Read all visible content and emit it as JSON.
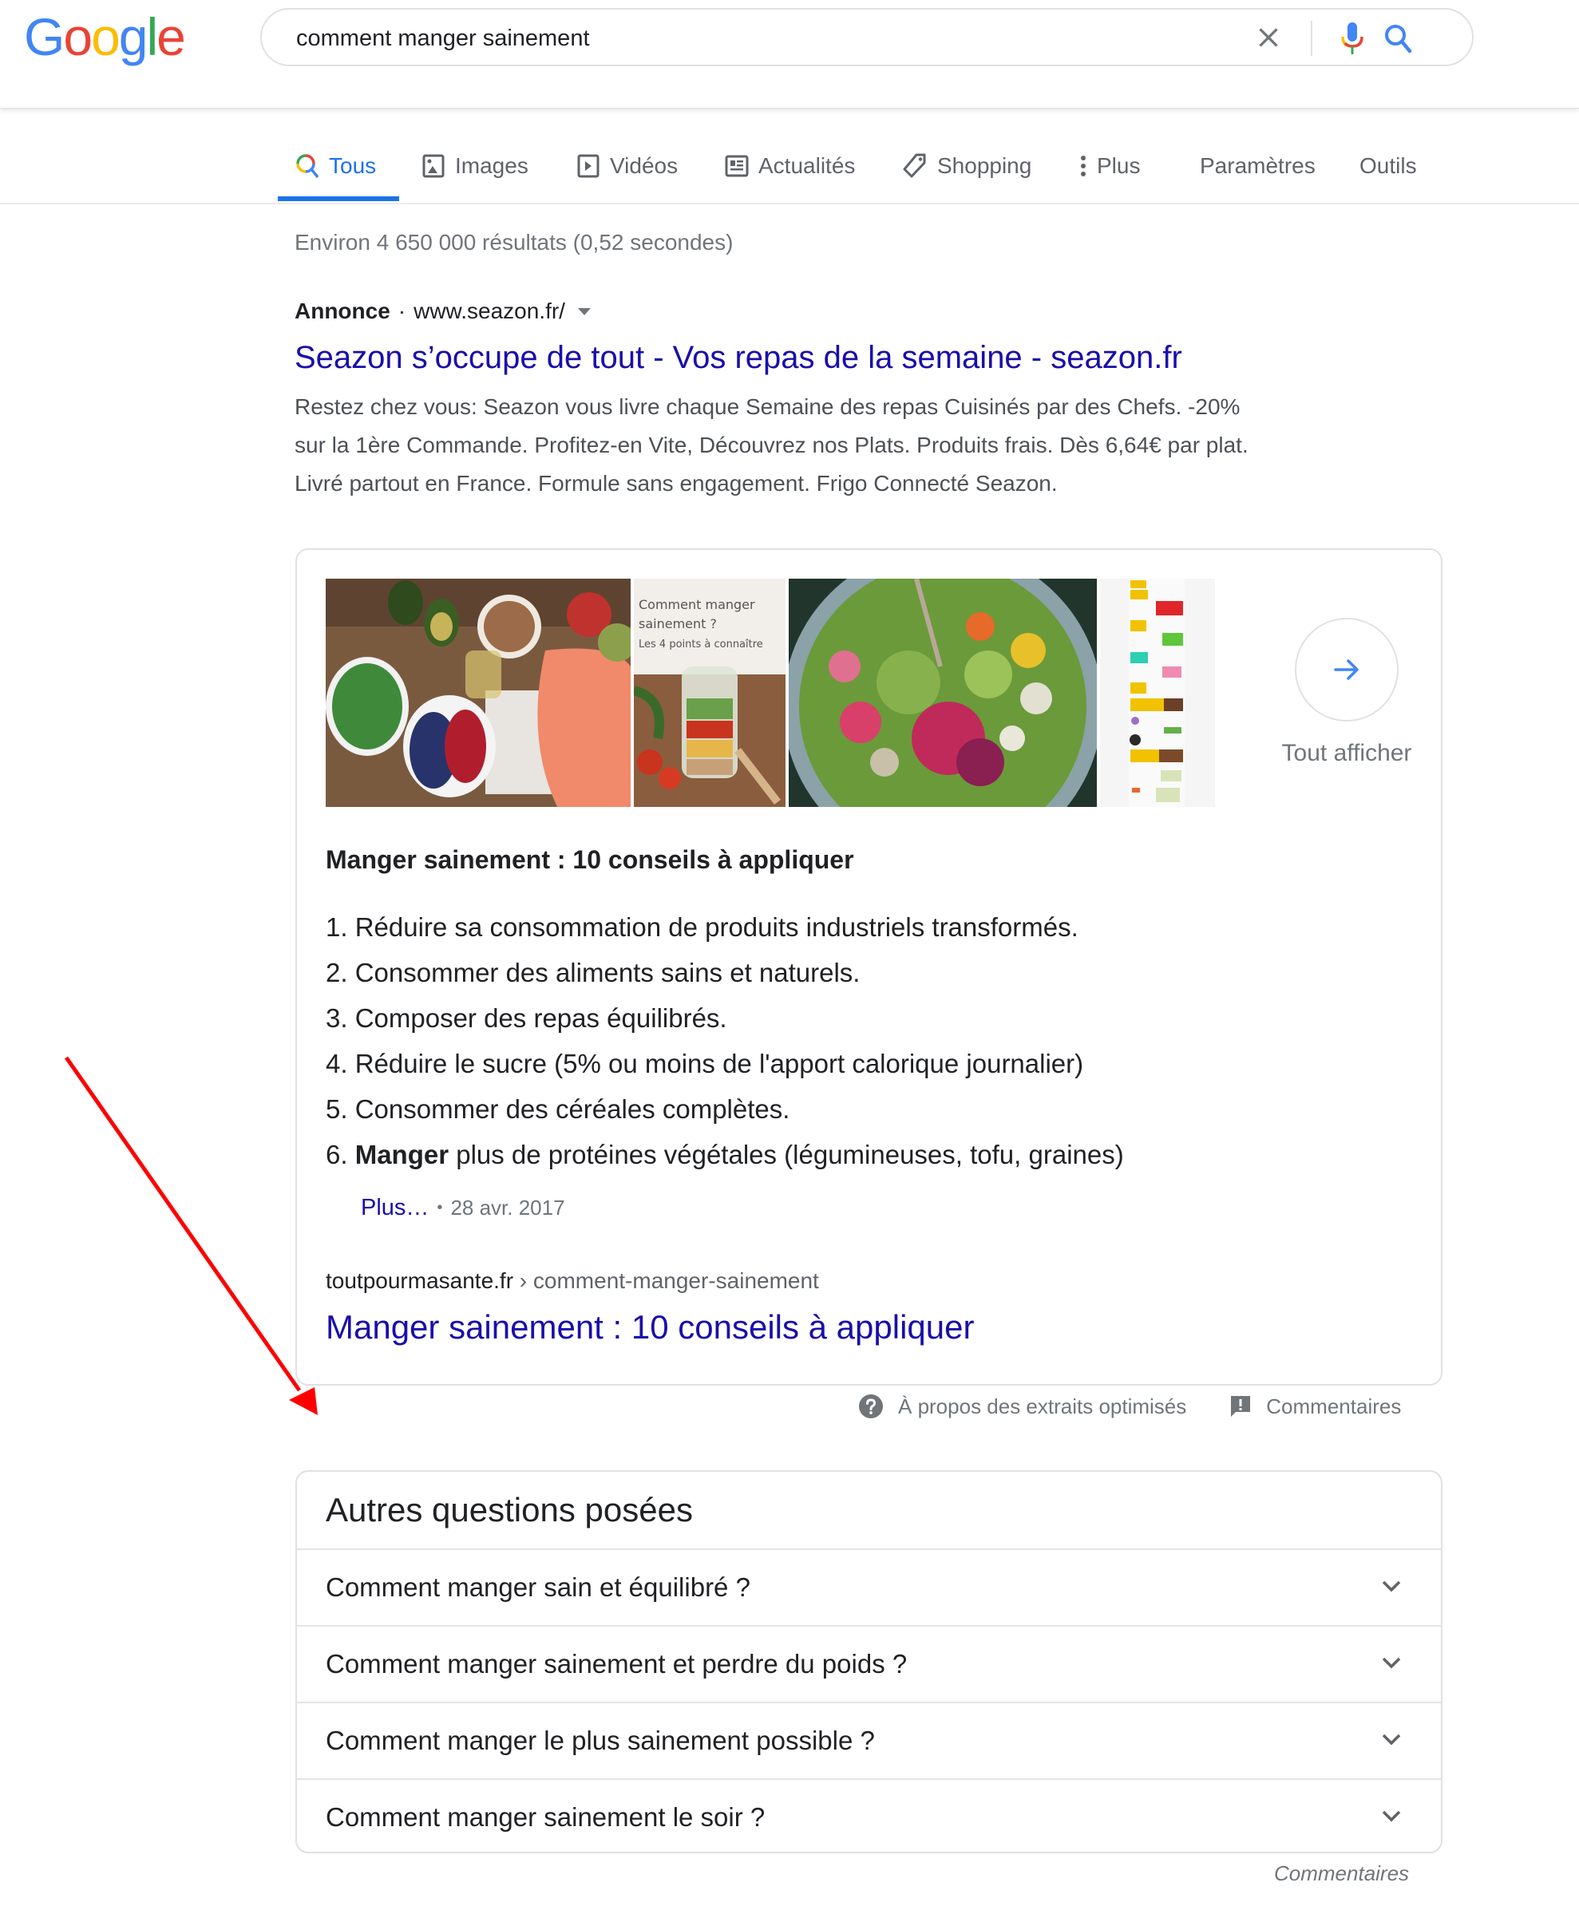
{
  "header": {
    "logo_letters": [
      {
        "char": "G",
        "color": "#4285F4"
      },
      {
        "char": "o",
        "color": "#EA4335"
      },
      {
        "char": "o",
        "color": "#FBBC05"
      },
      {
        "char": "g",
        "color": "#4285F4"
      },
      {
        "char": "l",
        "color": "#34A853"
      },
      {
        "char": "e",
        "color": "#EA4335"
      }
    ],
    "search_query": "comment manger sainement",
    "clear_icon": "close-icon",
    "mic_icon": "microphone-icon",
    "search_icon": "search-icon"
  },
  "tabs": {
    "items": [
      {
        "label": "Tous",
        "icon": "search-icon",
        "active": true
      },
      {
        "label": "Images",
        "icon": "image-icon"
      },
      {
        "label": "Vidéos",
        "icon": "play-icon"
      },
      {
        "label": "Actualités",
        "icon": "news-icon"
      },
      {
        "label": "Shopping",
        "icon": "tag-icon"
      },
      {
        "label": "Plus",
        "icon": "more-vert-icon"
      }
    ],
    "settings_label": "Paramètres",
    "tools_label": "Outils",
    "accent_color": "#1a73e8"
  },
  "stats": "Environ 4 650 000 résultats (0,52 secondes)",
  "ad": {
    "label": "Annonce",
    "separator": "·",
    "url": "www.seazon.fr/",
    "title": "Seazon s’occupe de tout - Vos repas de la semaine - seazon.fr",
    "description_lines": [
      "Restez chez vous: Seazon vous livre chaque Semaine des repas Cuisinés par des Chefs. -20%",
      "sur la 1ère Commande. Profitez-en Vite, Découvrez nos Plats. Produits frais. Dès 6,64€ par plat.",
      "Livré partout en France. Formule sans engagement. Frigo Connecté Seazon."
    ]
  },
  "featured_snippet": {
    "images": [
      {
        "alt": "Aliments sains : saumon, épinards, baies, avocats, noix"
      },
      {
        "alt": "Comment manger sainement ? Les 4 points à connaître",
        "overlay_text": [
          "Comment manger",
          "sainement ?",
          "Les 4 points à connaître"
        ]
      },
      {
        "alt": "Salade colorée de légumes et fleurs"
      },
      {
        "alt": "Infographie alimentation"
      }
    ],
    "see_all_label": "Tout afficher",
    "heading": "Manger sainement : 10 conseils à appliquer",
    "list": [
      {
        "num": "1.",
        "bold": "",
        "text": "Réduire sa consommation de produits industriels transformés."
      },
      {
        "num": "2.",
        "bold": "",
        "text": "Consommer des aliments sains et naturels."
      },
      {
        "num": "3.",
        "bold": "",
        "text": "Composer des repas équilibrés."
      },
      {
        "num": "4.",
        "bold": "",
        "text": "Réduire le sucre (5% ou moins de l'apport calorique journalier)"
      },
      {
        "num": "5.",
        "bold": "",
        "text": "Consommer des céréales complètes."
      },
      {
        "num": "6.",
        "bold": "Manger",
        "text": " plus de protéines végétales (légumineuses, tofu, graines)"
      }
    ],
    "more_label": "Plus…",
    "bullet": "•",
    "date": "28 avr. 2017",
    "source_domain": "toutpourmasante.fr",
    "source_path": " › comment-manger-sainement",
    "source_title": "Manger sainement : 10 conseils à appliquer",
    "footer_about": "À propos des extraits optimisés",
    "footer_feedback": "Commentaires"
  },
  "people_also_ask": {
    "title": "Autres questions posées",
    "questions": [
      "Comment manger sain et équilibré ?",
      "Comment manger sainement et perdre du poids ?",
      "Comment manger le plus sainement possible ?",
      "Comment manger sainement le soir ?"
    ],
    "feedback_label": "Commentaires"
  },
  "annotation": {
    "type": "arrow",
    "color": "#ff0000",
    "points_to": "people-also-ask"
  }
}
